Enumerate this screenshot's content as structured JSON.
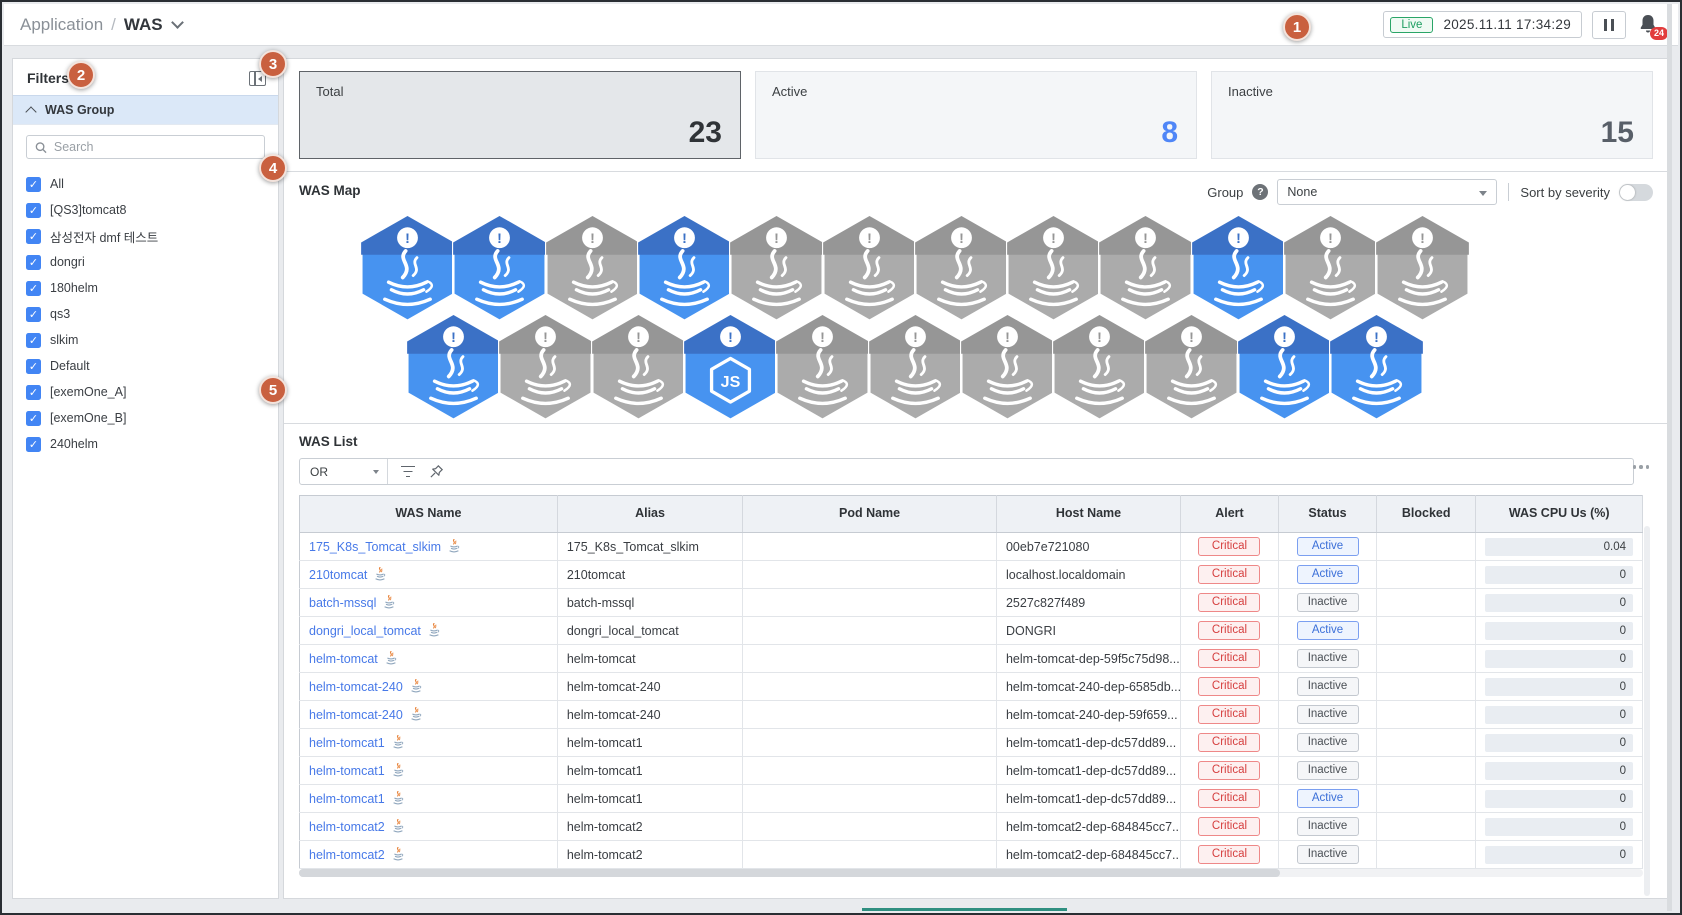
{
  "header": {
    "breadcrumb_root": "Application",
    "breadcrumb_sep": "/",
    "breadcrumb_current": "WAS",
    "live_label": "Live",
    "timestamp": "2025.11.11 17:34:29",
    "alarm_count": "24"
  },
  "annotations": [
    "1",
    "2",
    "3",
    "4",
    "5"
  ],
  "sidebar": {
    "title": "Filters",
    "group_title": "WAS Group",
    "search_placeholder": "Search",
    "items": [
      {
        "label": "All",
        "checked": true
      },
      {
        "label": "[QS3]tomcat8",
        "checked": true
      },
      {
        "label": "삼성전자 dmf 테스트",
        "checked": true
      },
      {
        "label": "dongri",
        "checked": true
      },
      {
        "label": "180helm",
        "checked": true
      },
      {
        "label": "qs3",
        "checked": true
      },
      {
        "label": "slkim",
        "checked": true
      },
      {
        "label": "Default",
        "checked": true
      },
      {
        "label": "[exemOne_A]",
        "checked": true
      },
      {
        "label": "[exemOne_B]",
        "checked": true
      },
      {
        "label": "240helm",
        "checked": true
      }
    ]
  },
  "summary_cards": [
    {
      "label": "Total",
      "value": "23",
      "state": "selected",
      "accent": "dark"
    },
    {
      "label": "Active",
      "value": "8",
      "state": "normal",
      "accent": "blue"
    },
    {
      "label": "Inactive",
      "value": "15",
      "state": "normal",
      "accent": "slate"
    }
  ],
  "was_map": {
    "title": "WAS Map",
    "group_label": "Group",
    "group_value": "None",
    "sort_label": "Sort by severity",
    "severity_toggle": "off",
    "rows": [
      [
        "active",
        "active",
        "inactive",
        "active",
        "inactive",
        "inactive",
        "inactive",
        "inactive",
        "inactive",
        "active",
        "inactive",
        "inactive"
      ],
      [
        "active",
        "inactive",
        "inactive",
        "active-js",
        "inactive",
        "inactive",
        "inactive",
        "inactive",
        "inactive",
        "active",
        "active"
      ]
    ]
  },
  "was_list": {
    "title": "WAS List",
    "operator": "OR",
    "columns": [
      "WAS Name",
      "Alias",
      "Pod Name",
      "Host Name",
      "Alert",
      "Status",
      "Blocked",
      "WAS CPU Us (%)"
    ],
    "rows": [
      {
        "name": "175_K8s_Tomcat_slkim",
        "alias": "175_K8s_Tomcat_slkim",
        "pod": "",
        "host": "00eb7e721080",
        "alert": "Critical",
        "status": "Active",
        "blocked": "",
        "cpu": "0.04"
      },
      {
        "name": "210tomcat",
        "alias": "210tomcat",
        "pod": "",
        "host": "localhost.localdomain",
        "alert": "Critical",
        "status": "Active",
        "blocked": "",
        "cpu": "0"
      },
      {
        "name": "batch-mssql",
        "alias": "batch-mssql",
        "pod": "",
        "host": "2527c827f489",
        "alert": "Critical",
        "status": "Inactive",
        "blocked": "",
        "cpu": "0"
      },
      {
        "name": "dongri_local_tomcat",
        "alias": "dongri_local_tomcat",
        "pod": "",
        "host": "DONGRI",
        "alert": "Critical",
        "status": "Active",
        "blocked": "",
        "cpu": "0"
      },
      {
        "name": "helm-tomcat",
        "alias": "helm-tomcat",
        "pod": "",
        "host": "helm-tomcat-dep-59f5c75d98...",
        "alert": "Critical",
        "status": "Inactive",
        "blocked": "",
        "cpu": "0"
      },
      {
        "name": "helm-tomcat-240",
        "alias": "helm-tomcat-240",
        "pod": "",
        "host": "helm-tomcat-240-dep-6585db...",
        "alert": "Critical",
        "status": "Inactive",
        "blocked": "",
        "cpu": "0"
      },
      {
        "name": "helm-tomcat-240",
        "alias": "helm-tomcat-240",
        "pod": "",
        "host": "helm-tomcat-240-dep-59f659...",
        "alert": "Critical",
        "status": "Inactive",
        "blocked": "",
        "cpu": "0"
      },
      {
        "name": "helm-tomcat1",
        "alias": "helm-tomcat1",
        "pod": "",
        "host": "helm-tomcat1-dep-dc57dd89...",
        "alert": "Critical",
        "status": "Inactive",
        "blocked": "",
        "cpu": "0"
      },
      {
        "name": "helm-tomcat1",
        "alias": "helm-tomcat1",
        "pod": "",
        "host": "helm-tomcat1-dep-dc57dd89...",
        "alert": "Critical",
        "status": "Inactive",
        "blocked": "",
        "cpu": "0"
      },
      {
        "name": "helm-tomcat1",
        "alias": "helm-tomcat1",
        "pod": "",
        "host": "helm-tomcat1-dep-dc57dd89...",
        "alert": "Critical",
        "status": "Active",
        "blocked": "",
        "cpu": "0"
      },
      {
        "name": "helm-tomcat2",
        "alias": "helm-tomcat2",
        "pod": "",
        "host": "helm-tomcat2-dep-684845cc7...",
        "alert": "Critical",
        "status": "Inactive",
        "blocked": "",
        "cpu": "0"
      },
      {
        "name": "helm-tomcat2",
        "alias": "helm-tomcat2",
        "pod": "",
        "host": "helm-tomcat2-dep-684845cc7...",
        "alert": "Critical",
        "status": "Inactive",
        "blocked": "",
        "cpu": "0"
      }
    ]
  },
  "colors": {
    "annotation": "#c9603f",
    "accent_blue": "#4f86f7",
    "hex_active_body": "#4793f0",
    "hex_active_top": "#3b71c6",
    "hex_inactive_body": "#ababab",
    "hex_inactive_top": "#969696",
    "critical_red": "#d64040",
    "live_green": "#1d9e61",
    "link_blue": "#4779e8"
  }
}
